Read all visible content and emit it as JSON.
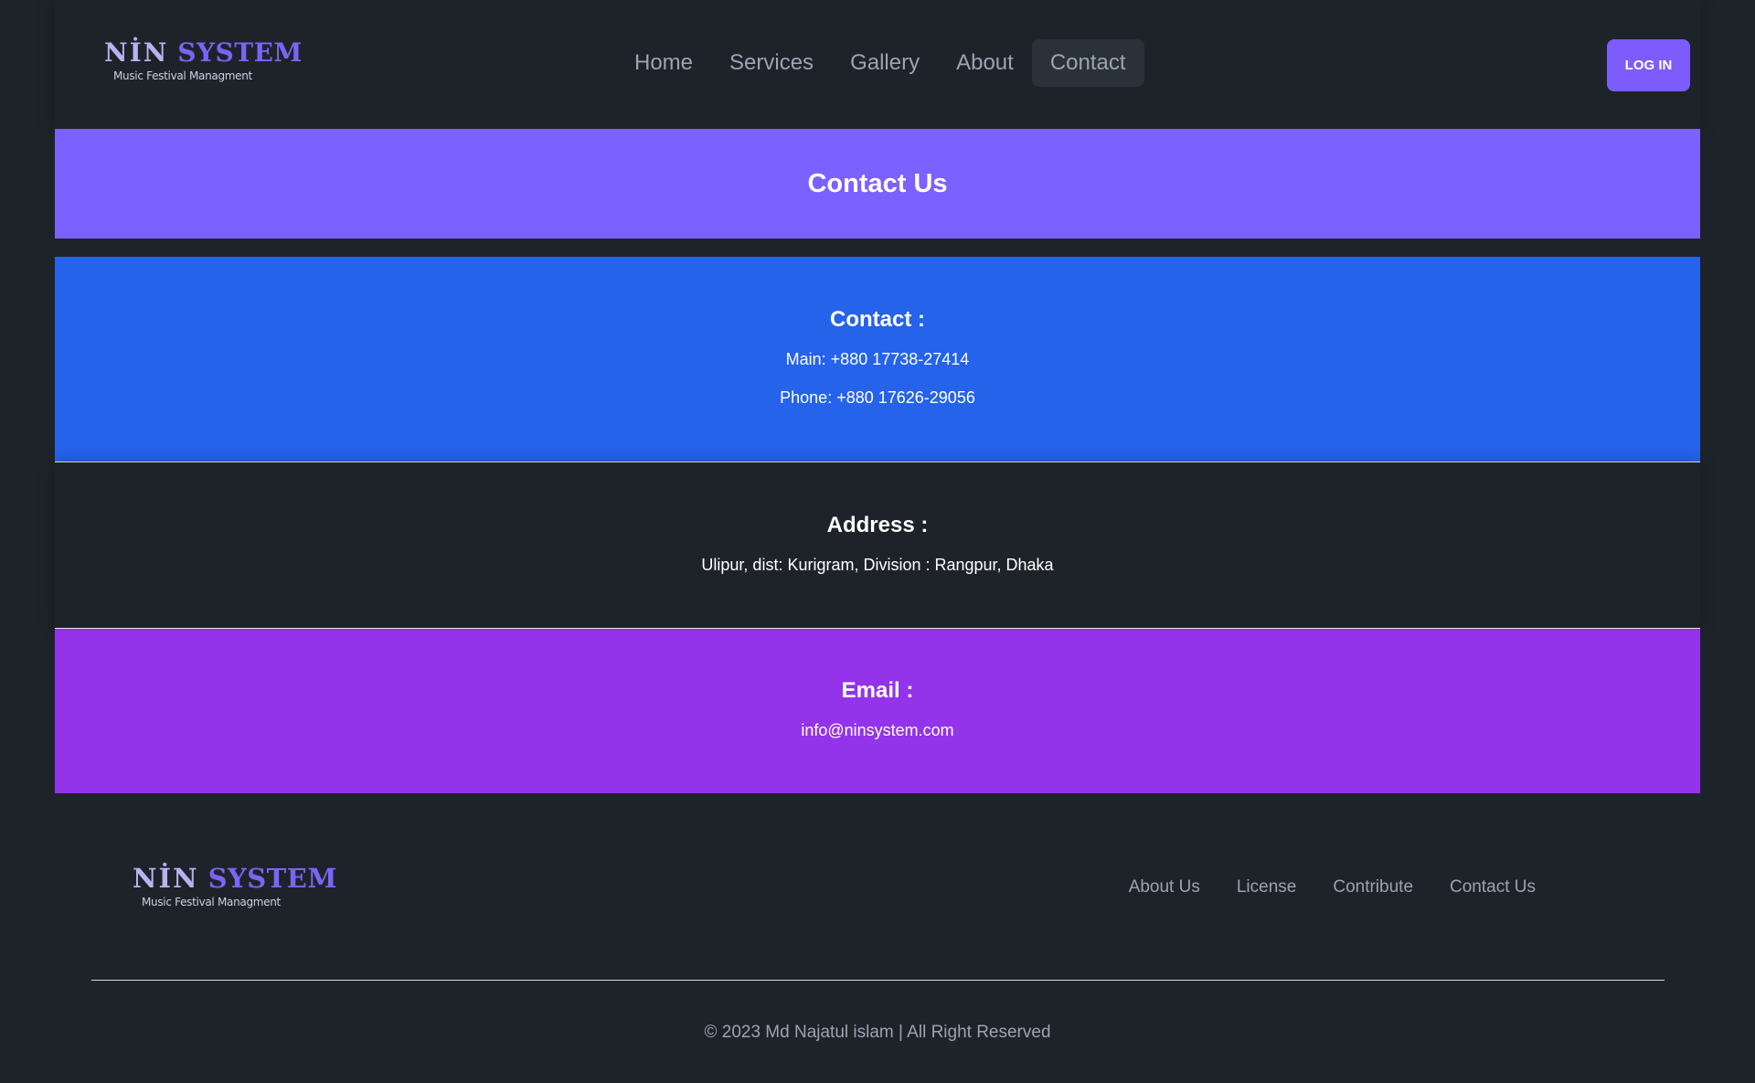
{
  "brand": {
    "name_part1": "NİN",
    "name_part2": "SYSTEM",
    "tagline": "Music Festival Managment"
  },
  "nav": {
    "links": [
      "Home",
      "Services",
      "Gallery",
      "About",
      "Contact"
    ],
    "active": "Contact",
    "login_label": "LOG IN"
  },
  "banner": {
    "title": "Contact Us"
  },
  "contact": {
    "heading": "Contact :",
    "main": "Main: +880 17738-27414",
    "phone": "Phone: +880 17626-29056"
  },
  "address": {
    "heading": "Address :",
    "line": "Ulipur, dist: Kurigram, Division : Rangpur, Dhaka"
  },
  "email": {
    "heading": "Email :",
    "value": "info@ninsystem.com"
  },
  "footer": {
    "links": [
      "About Us",
      "License",
      "Contribute",
      "Contact Us"
    ],
    "copyright": "© 2023 Md Najatul islam | All Right Reserved"
  },
  "colors": {
    "page_bg": "#1e2329",
    "accent_purple": "#7b61ff",
    "contact_blue": "#2563eb",
    "email_purple": "#9333ea",
    "nav_text": "#9aa4b3"
  }
}
